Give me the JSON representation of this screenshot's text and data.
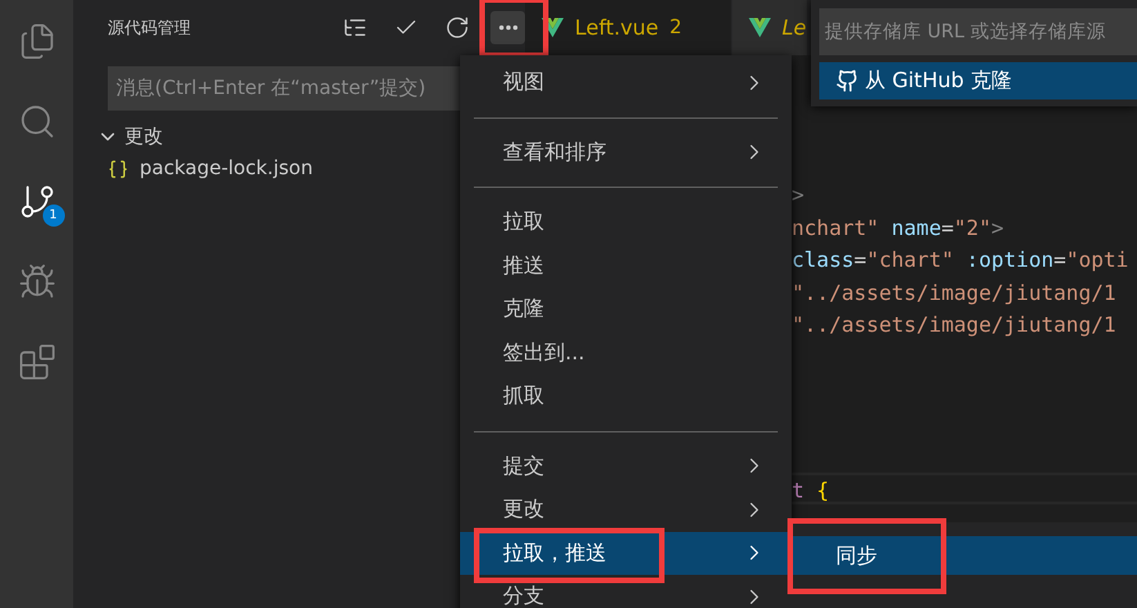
{
  "activity_bar": {
    "items": [
      {
        "kind": "files",
        "selected": false
      },
      {
        "kind": "search",
        "selected": false
      },
      {
        "kind": "source-control",
        "selected": true,
        "badge": "1"
      },
      {
        "kind": "debug",
        "selected": false
      },
      {
        "kind": "extensions",
        "selected": false
      }
    ]
  },
  "sidebar": {
    "title": "源代码管理",
    "actions": [
      {
        "kind": "tree",
        "highlighted": false
      },
      {
        "kind": "check",
        "highlighted": false
      },
      {
        "kind": "refresh",
        "highlighted": false
      },
      {
        "kind": "more",
        "highlighted": true
      }
    ],
    "commit_message": {
      "placeholder": "消息(Ctrl+Enter 在“master”提交)"
    },
    "section": {
      "title": "更改",
      "expanded": true,
      "files": [
        {
          "name": "package-lock.json"
        }
      ]
    }
  },
  "tabs": [
    {
      "label": "Left.vue",
      "badge": "2",
      "selected": true
    },
    {
      "label": "Le",
      "selected": false
    }
  ],
  "code_lines": [
    {
      "tokens": [
        {
          "kind": "punct",
          "text": ">"
        }
      ]
    },
    {
      "tokens": [
        {
          "kind": "string",
          "text": "nchart\""
        },
        {
          "kind": "attr",
          "text": " name"
        },
        {
          "kind": "plain",
          "text": "="
        },
        {
          "kind": "string",
          "text": "\"2\""
        },
        {
          "kind": "punct",
          "text": ">"
        }
      ]
    },
    {
      "tokens": [
        {
          "kind": "attr",
          "text": "class"
        },
        {
          "kind": "plain",
          "text": "="
        },
        {
          "kind": "string",
          "text": "\"chart\""
        },
        {
          "kind": "attr",
          "text": " :option"
        },
        {
          "kind": "plain",
          "text": "="
        },
        {
          "kind": "string",
          "text": "\"opti"
        }
      ]
    },
    {
      "tokens": [
        {
          "kind": "string",
          "text": "\"../assets/image/jiutang/1"
        }
      ]
    },
    {
      "tokens": [
        {
          "kind": "string",
          "text": "\"../assets/image/jiutang/1"
        }
      ]
    },
    {
      "tokens": [
        {
          "kind": "keyword",
          "text": "t"
        },
        {
          "kind": "brace",
          "text": " {"
        }
      ],
      "current": true
    }
  ],
  "menu": {
    "items": [
      {
        "kind": "item",
        "label": "视图",
        "submenu": true,
        "selected": false,
        "highlighted": false
      },
      {
        "kind": "separator"
      },
      {
        "kind": "item",
        "label": "查看和排序",
        "submenu": true,
        "selected": false,
        "highlighted": false
      },
      {
        "kind": "separator"
      },
      {
        "kind": "item",
        "label": "拉取",
        "submenu": false,
        "selected": false,
        "highlighted": false
      },
      {
        "kind": "item",
        "label": "推送",
        "submenu": false,
        "selected": false,
        "highlighted": false
      },
      {
        "kind": "item",
        "label": "克隆",
        "submenu": false,
        "selected": false,
        "highlighted": false
      },
      {
        "kind": "item",
        "label": "签出到...",
        "submenu": false,
        "selected": false,
        "highlighted": false
      },
      {
        "kind": "item",
        "label": "抓取",
        "submenu": false,
        "selected": false,
        "highlighted": false
      },
      {
        "kind": "separator"
      },
      {
        "kind": "item",
        "label": "提交",
        "submenu": true,
        "selected": false,
        "highlighted": false
      },
      {
        "kind": "item",
        "label": "更改",
        "submenu": true,
        "selected": false,
        "highlighted": false
      },
      {
        "kind": "item",
        "label": "拉取，推送",
        "submenu": true,
        "selected": true,
        "highlighted": true
      },
      {
        "kind": "item",
        "label": "分支",
        "submenu": true,
        "selected": false,
        "highlighted": false
      }
    ]
  },
  "submenu": {
    "items": [
      {
        "label": "同步",
        "selected": true,
        "highlighted": true
      }
    ]
  },
  "quick_pick": {
    "placeholder": "提供存储库 URL 或选择存储库源",
    "items": [
      {
        "label": "从 GitHub 克隆",
        "selected": true
      }
    ]
  }
}
